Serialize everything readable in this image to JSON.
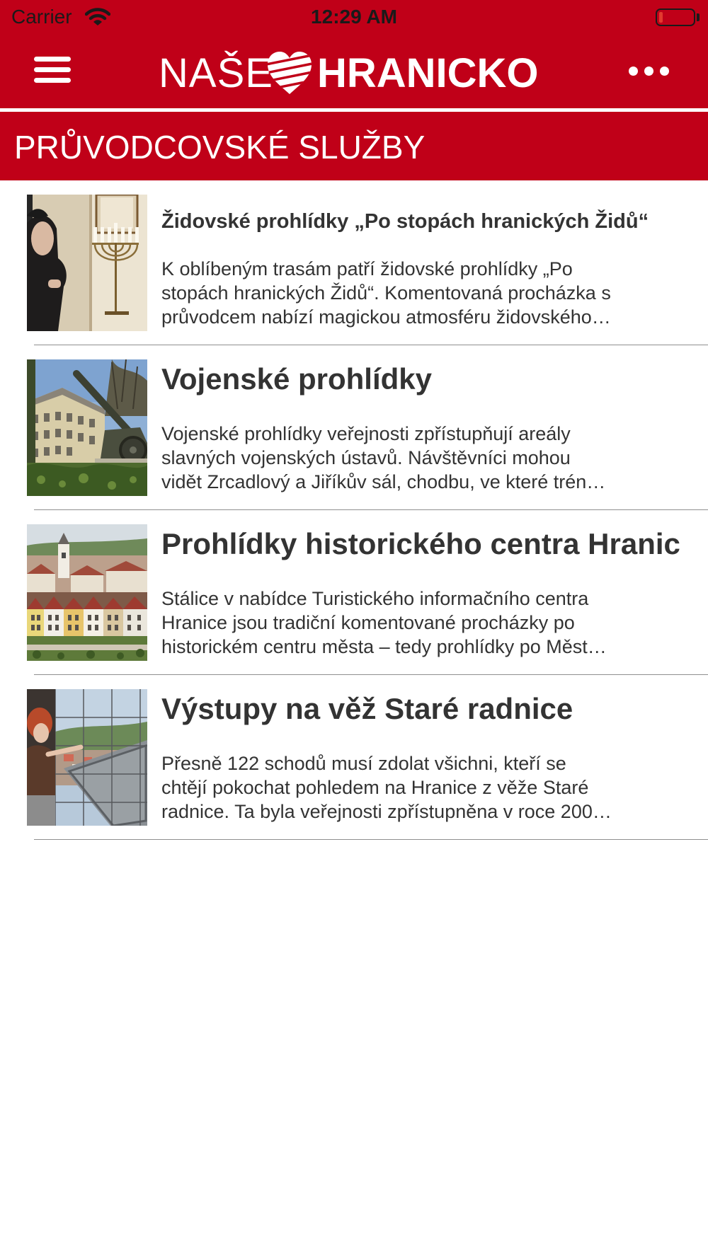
{
  "status_bar": {
    "carrier": "Carrier",
    "time": "12:29 AM",
    "battery_level": 0.1,
    "battery_color": "#e23a2e"
  },
  "header": {
    "logo_left": "NAŠE",
    "logo_right": "HRANICKO",
    "menu_icon": "hamburger-menu-icon",
    "more_icon": "more-dots-icon",
    "logo_icon": "heart-logo-icon",
    "background_color": "#c00018"
  },
  "section": {
    "title": "PRŮVODCOVSKÉ SLUŽBY"
  },
  "items": [
    {
      "title": "Židovské prohlídky „Po stopách hranických Židů“",
      "lines": [
        "K oblíbeným trasám patří židovské prohlídky „Po",
        "stopách hranických Židů“. Komentovaná procházka s",
        "průvodcem nabízí magickou atmosféru židovského…"
      ]
    },
    {
      "title": "Vojenské prohlídky",
      "lines": [
        "Vojenské prohlídky veřejnosti zpřístupňují areály",
        "slavných vojenských ústavů. Návštěvníci mohou",
        "vidět Zrcadlový a Jiříkův sál, chodbu, ve které trén…"
      ]
    },
    {
      "title": "Prohlídky historického centra Hranic",
      "lines": [
        "Stálice v nabídce Turistického informačního centra",
        "Hranice jsou tradiční komentované procházky po",
        "historickém centru města – tedy prohlídky po Měst…"
      ]
    },
    {
      "title": "Výstupy na věž Staré radnice",
      "lines": [
        "Přesně 122 schodů musí zdolat všichni, kteří se",
        "chtějí pokochat pohledem na Hranice z věže Staré",
        "radnice. Ta byla veřejnosti zpřístupněna v roce 200…"
      ]
    }
  ]
}
